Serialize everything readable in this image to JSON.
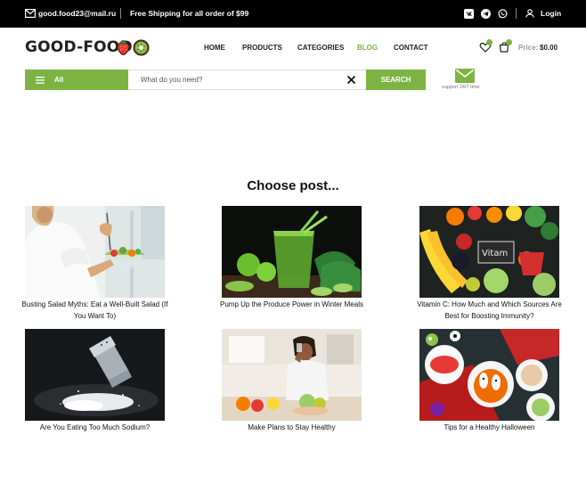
{
  "topbar": {
    "email": "good.food23@mail.ru",
    "shipping": "Free Shipping for all order of $99",
    "login": "Login"
  },
  "header": {
    "logo": "GOOD-FOOD",
    "nav": [
      "HOME",
      "PRODUCTS",
      "CATEGORIES",
      "BLOG",
      "CONTACT"
    ],
    "active_nav": "BLOG",
    "price_label": "Price:",
    "price_value": "$0.00"
  },
  "search": {
    "all_label": "All",
    "placeholder": "What do you need?",
    "button_label": "SEARCH",
    "support_text": "support 24/7 time"
  },
  "main": {
    "title": "Choose post...",
    "posts": [
      {
        "caption": "Busting Salad Myths: Eat a Well-Built Salad (If You Want To)"
      },
      {
        "caption": "Pump Up the Produce Power in Winter Meals"
      },
      {
        "caption": "Vitamin C: How Much and Which Sources Are Best for Boosting Immunity?"
      },
      {
        "caption": "Are You Eating Too Much Sodium?"
      },
      {
        "caption": "Make Plans to Stay Healthy"
      },
      {
        "caption": "Tips for a Healthy Halloween"
      }
    ]
  },
  "colors": {
    "accent": "#7cb342",
    "topbar": "#000000"
  }
}
